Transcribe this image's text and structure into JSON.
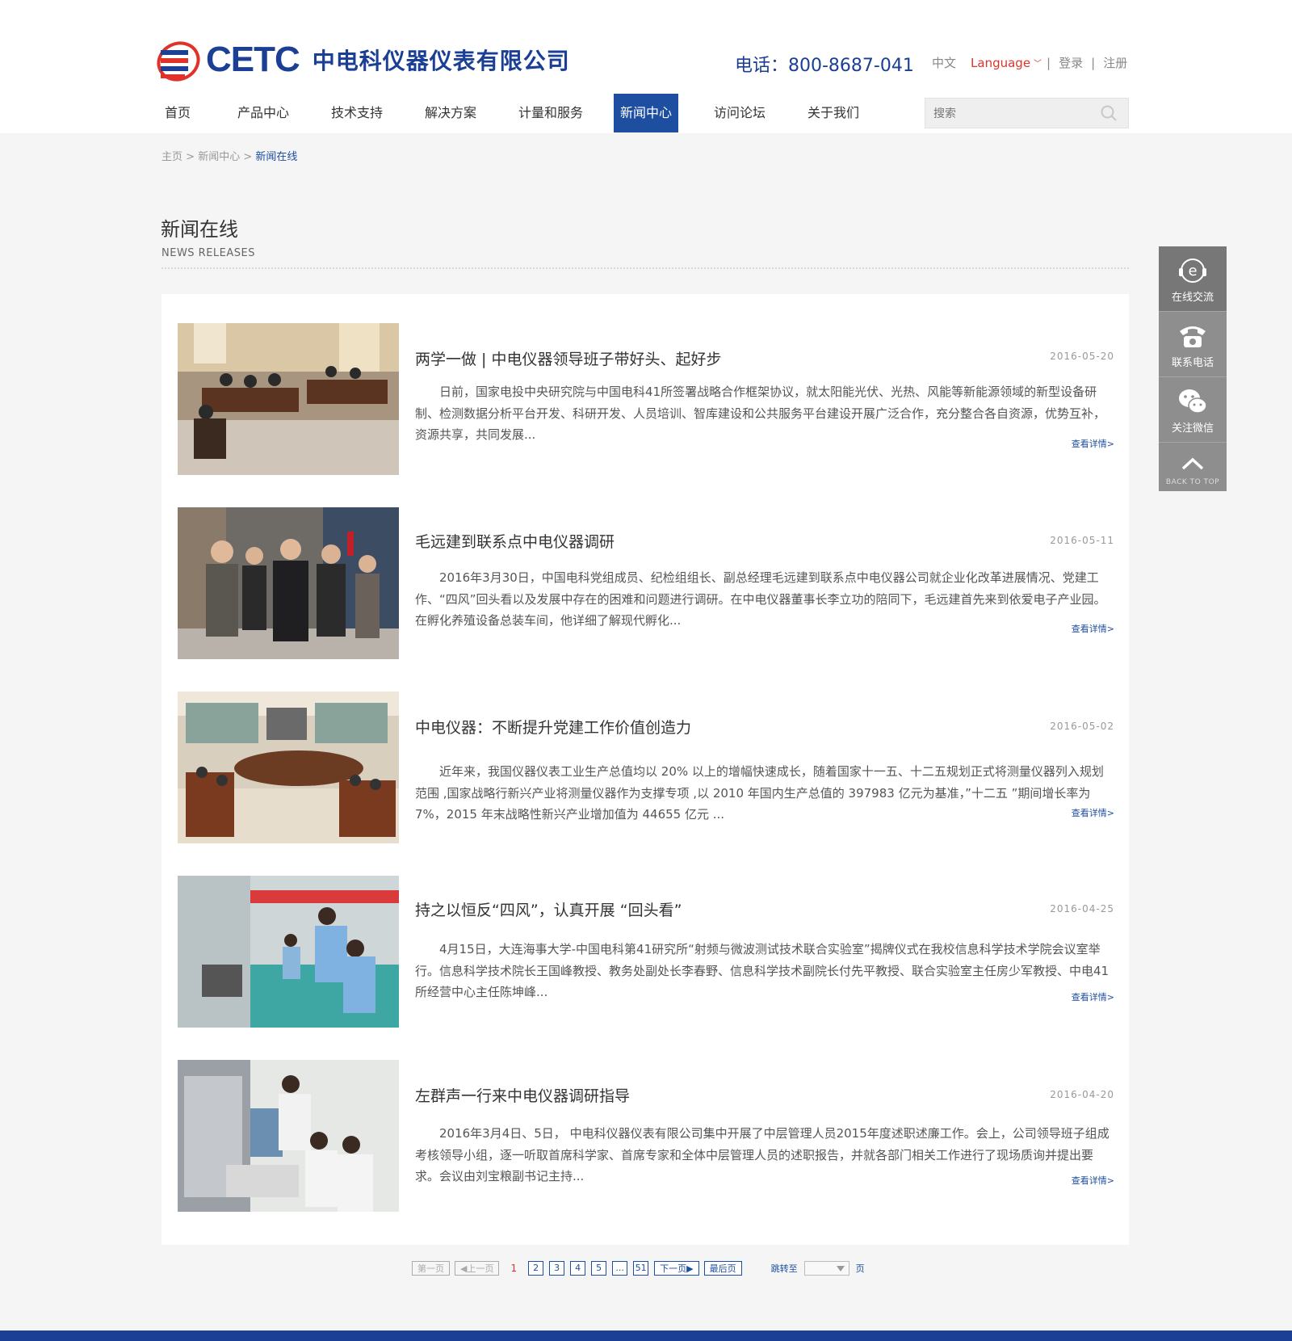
{
  "header": {
    "logo_text": "CETC",
    "company_name": "中电科仪器仪表有限公司",
    "phone": "电话：800-8687-041",
    "lang_cn": "中文",
    "language": "Language",
    "login": "登录",
    "register": "注册",
    "sep": "|"
  },
  "nav": {
    "items": [
      "首页",
      "产品中心",
      "技术支持",
      "解决方案",
      "计量和服务",
      "新闻中心",
      "访问论坛",
      "关于我们"
    ],
    "active": "新闻中心"
  },
  "search": {
    "placeholder": "搜索"
  },
  "breadcrumb": {
    "home": "主页",
    "parent": "新闻中心",
    "current": "新闻在线",
    "sep": ">"
  },
  "section": {
    "title": "新闻在线",
    "subtitle": "NEWS RELEASES"
  },
  "news": [
    {
      "title": "两学一做 | 中电仪器领导班子带好头、起好步",
      "date": "2016-05-20",
      "summary": "日前，国家电投中央研究院与中国电科41所签署战略合作框架协议，就太阳能光伏、光热、风能等新能源领域的新型设备研制、检测数据分析平台开发、科研开发、人员培训、智库建设和公共服务平台建设开展广泛合作，充分整合各自资源，优势互补，资源共享，共同发展...",
      "more": "查看详情>"
    },
    {
      "title": "毛远建到联系点中电仪器调研",
      "date": "2016-05-11",
      "summary": "2016年3月30日，中国电科党组成员、纪检组组长、副总经理毛远建到联系点中电仪器公司就企业化改革进展情况、党建工作、“四风”回头看以及发展中存在的困难和问题进行调研。在中电仪器董事长李立功的陪同下，毛远建首先来到依爱电子产业园。在孵化养殖设备总装车间，他详细了解现代孵化...",
      "more": "查看详情>"
    },
    {
      "title": "中电仪器：不断提升党建工作价值创造力",
      "date": "2016-05-02",
      "summary": "近年来，我国仪器仪表工业生产总值均以 20% 以上的增幅快速成长，随着国家十一五、十二五规划正式将测量仪器列入规划范围 ,国家战略行新兴产业将测量仪器作为支撑专项 ,以 2010 年国内生产总值的 397983 亿元为基准，”十二五 ”期间增长率为 7%，2015 年末战略性新兴产业增加值为 44655 亿元 ...",
      "more": "查看详情>"
    },
    {
      "title": "持之以恒反“四风”，认真开展 “回头看”",
      "date": "2016-04-25",
      "summary": "4月15日，大连海事大学-中国电科第41研究所“射频与微波测试技术联合实验室”揭牌仪式在我校信息科学技术学院会议室举行。信息科学技术院长王国峰教授、教务处副处长李春野、信息科学技术副院长付先平教授、联合实验室主任房少军教授、中电41所经营中心主任陈坤峰...",
      "more": "查看详情>"
    },
    {
      "title": "左群声一行来中电仪器调研指导",
      "date": "2016-04-20",
      "summary": "2016年3月4日、5日， 中电科仪器仪表有限公司集中开展了中层管理人员2015年度述职述廉工作。会上，公司领导班子组成考核领导小组，逐一听取首席科学家、首席专家和全体中层管理人员的述职报告，并就各部门相关工作进行了现场质询并提出要求。会议由刘宝粮副书记主持...",
      "more": "查看详情>"
    }
  ],
  "pagination": {
    "first": "第一页",
    "prev": "上一页",
    "current": "1",
    "pages": [
      "2",
      "3",
      "4",
      "5",
      "...",
      "51"
    ],
    "next": "下一页",
    "last": "最后页",
    "jump_label": "跳转至",
    "page_unit": "页"
  },
  "sidebar": {
    "chat": "在线交流",
    "phone": "联系电话",
    "wechat": "关注微信",
    "top": "BACK TO TOP"
  },
  "colors": {
    "brand": "#1b3f95",
    "nav_active": "#1d4ea0",
    "accent_red": "#e0322b"
  }
}
